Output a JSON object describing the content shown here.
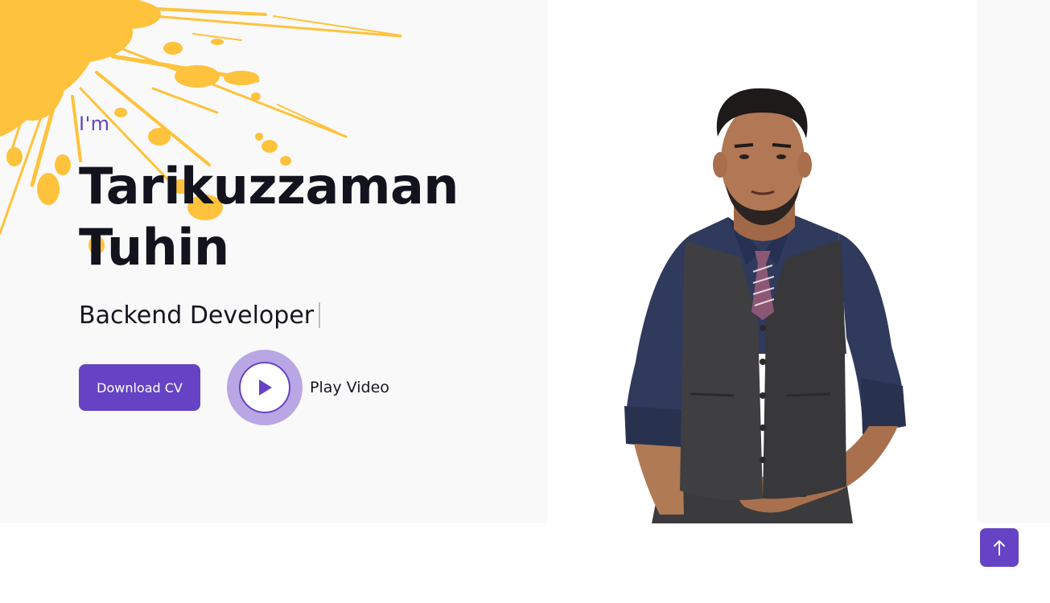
{
  "hero": {
    "greeting": "I'm",
    "name_line1": "Tarikuzzaman",
    "name_line2": "Tuhin",
    "role": "Backend Developer",
    "download_label": "Download CV",
    "play_label": "Play Video"
  },
  "icons": {
    "play": "play-icon",
    "scroll_top": "arrow-up-icon",
    "splash": "paint-splash-decoration"
  },
  "colors": {
    "accent": "#6543c4",
    "accent_light": "#b8a7e4",
    "splash": "#ffc23c",
    "heading": "#13131d",
    "hero_bg": "#f9f9f9"
  }
}
